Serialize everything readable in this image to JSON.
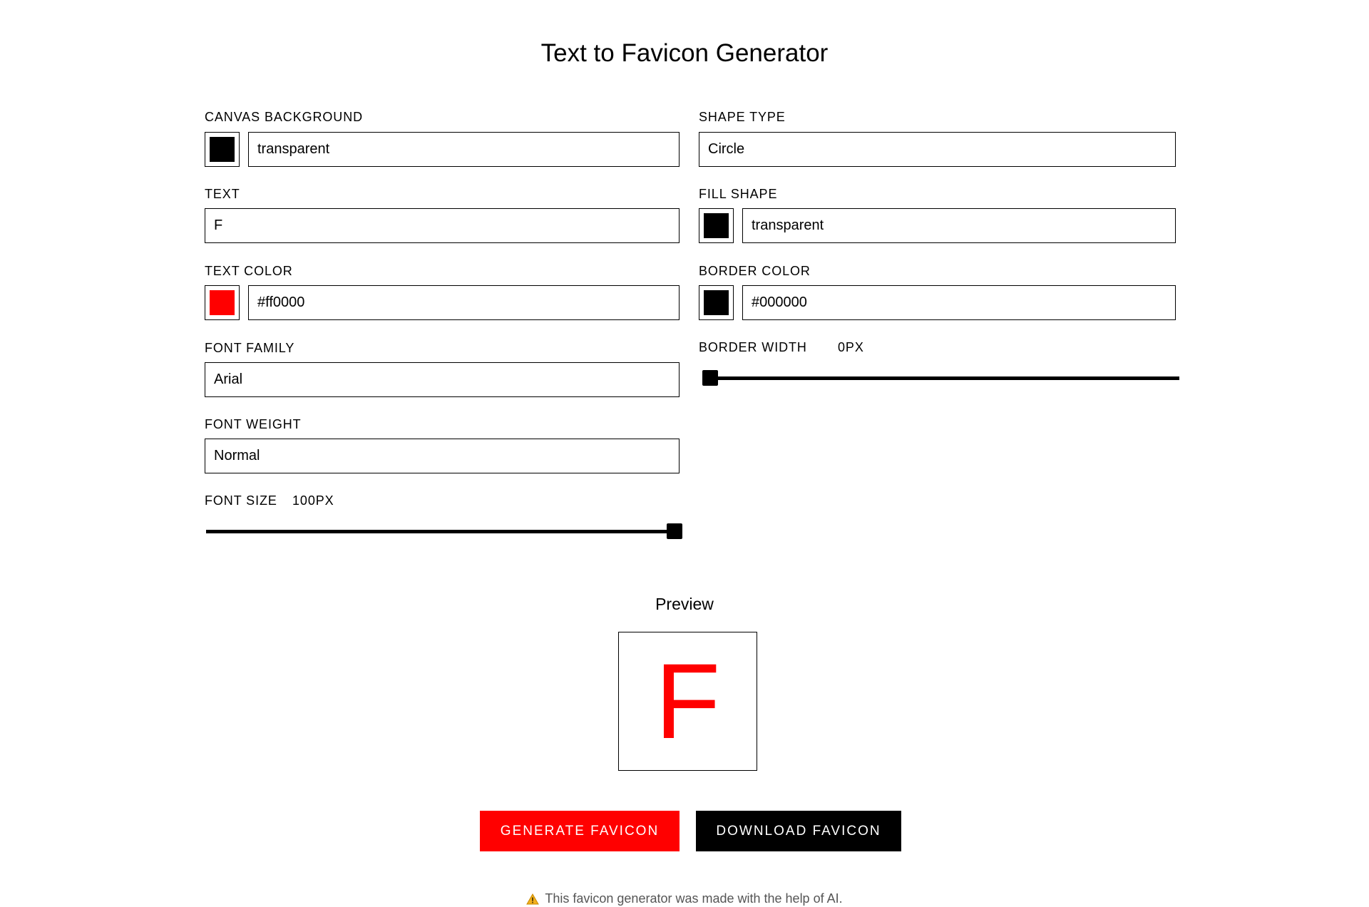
{
  "title": "Text to Favicon Generator",
  "colors": {
    "accent": "#ff0000",
    "dark": "#000000"
  },
  "left": {
    "canvas_background": {
      "label": "Canvas Background",
      "swatch": "#000000",
      "value": "transparent"
    },
    "text": {
      "label": "Text",
      "value": "F"
    },
    "text_color": {
      "label": "Text Color",
      "swatch": "#ff0000",
      "value": "#ff0000"
    },
    "font_family": {
      "label": "Font Family",
      "value": "Arial"
    },
    "font_weight": {
      "label": "Font Weight",
      "value": "Normal"
    },
    "font_size": {
      "label": "Font Size",
      "value_text": "100PX",
      "value": 100,
      "fraction": 1.0
    }
  },
  "right": {
    "shape_type": {
      "label": "Shape Type",
      "value": "Circle"
    },
    "fill_shape": {
      "label": "Fill Shape",
      "swatch": "#000000",
      "value": "transparent"
    },
    "border_color": {
      "label": "Border Color",
      "swatch": "#000000",
      "value": "#000000"
    },
    "border_width": {
      "label": "Border Width",
      "value_text": "0PX",
      "value": 0,
      "fraction": 0.0
    }
  },
  "preview": {
    "heading": "Preview",
    "letter": "F",
    "letter_color": "#ff0000"
  },
  "buttons": {
    "generate": "Generate Favicon",
    "download": "Download Favicon"
  },
  "footer": {
    "icon": "warning-icon",
    "text": "This favicon generator was made with the help of AI."
  }
}
